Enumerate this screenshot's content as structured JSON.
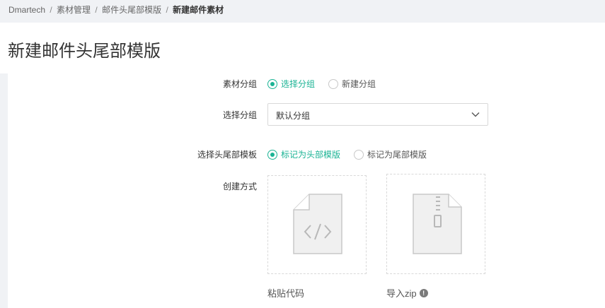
{
  "breadcrumb": {
    "items": [
      "Dmartech",
      "素材管理",
      "邮件头尾部模版"
    ],
    "current": "新建邮件素材",
    "separator": "/"
  },
  "page": {
    "title": "新建邮件头尾部模版"
  },
  "form": {
    "group_mode": {
      "label": "素材分组",
      "options": [
        {
          "label": "选择分组",
          "checked": true
        },
        {
          "label": "新建分组",
          "checked": false
        }
      ]
    },
    "select_group": {
      "label": "选择分组",
      "value": "默认分组"
    },
    "template_type": {
      "label": "选择头尾部模板",
      "options": [
        {
          "label": "标记为头部模版",
          "checked": true
        },
        {
          "label": "标记为尾部模版",
          "checked": false
        }
      ]
    },
    "create_method": {
      "label": "创建方式",
      "options": [
        {
          "label": "粘贴代码",
          "icon": "code-file-icon"
        },
        {
          "label": "导入zip",
          "icon": "zip-file-icon",
          "info_icon": "!"
        }
      ]
    }
  },
  "colors": {
    "accent": "#1ab394",
    "background_gray": "#f0f2f5",
    "icon_gray": "#f0f0f0",
    "icon_stroke": "#c8c8c8"
  }
}
